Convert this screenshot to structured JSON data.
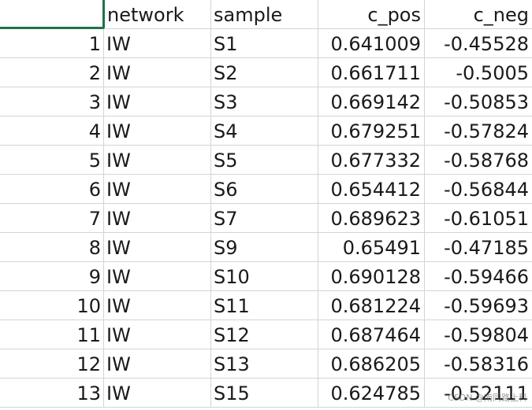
{
  "columns": {
    "index": "",
    "network": "network",
    "sample": "sample",
    "c_pos": "c_pos",
    "c_neg": "c_neg"
  },
  "rows": [
    {
      "index": "1",
      "network": "IW",
      "sample": "S1",
      "c_pos": "0.641009",
      "c_neg": "-0.45528"
    },
    {
      "index": "2",
      "network": "IW",
      "sample": "S2",
      "c_pos": "0.661711",
      "c_neg": "-0.5005"
    },
    {
      "index": "3",
      "network": "IW",
      "sample": "S3",
      "c_pos": "0.669142",
      "c_neg": "-0.50853"
    },
    {
      "index": "4",
      "network": "IW",
      "sample": "S4",
      "c_pos": "0.679251",
      "c_neg": "-0.57824"
    },
    {
      "index": "5",
      "network": "IW",
      "sample": "S5",
      "c_pos": "0.677332",
      "c_neg": "-0.58768"
    },
    {
      "index": "6",
      "network": "IW",
      "sample": "S6",
      "c_pos": "0.654412",
      "c_neg": "-0.56844"
    },
    {
      "index": "7",
      "network": "IW",
      "sample": "S7",
      "c_pos": "0.689623",
      "c_neg": "-0.61051"
    },
    {
      "index": "8",
      "network": "IW",
      "sample": "S9",
      "c_pos": "0.65491",
      "c_neg": "-0.47185"
    },
    {
      "index": "9",
      "network": "IW",
      "sample": "S10",
      "c_pos": "0.690128",
      "c_neg": "-0.59466"
    },
    {
      "index": "10",
      "network": "IW",
      "sample": "S11",
      "c_pos": "0.681224",
      "c_neg": "-0.59693"
    },
    {
      "index": "11",
      "network": "IW",
      "sample": "S12",
      "c_pos": "0.687464",
      "c_neg": "-0.59804"
    },
    {
      "index": "12",
      "network": "IW",
      "sample": "S13",
      "c_pos": "0.686205",
      "c_neg": "-0.58316"
    },
    {
      "index": "13",
      "network": "IW",
      "sample": "S15",
      "c_pos": "0.624785",
      "c_neg": "-0.52111"
    }
  ],
  "watermark": "CSDN @南同路上科",
  "colors": {
    "selection": "#217346",
    "gridline": "#d4d4d4",
    "text": "#1a1a1a"
  }
}
